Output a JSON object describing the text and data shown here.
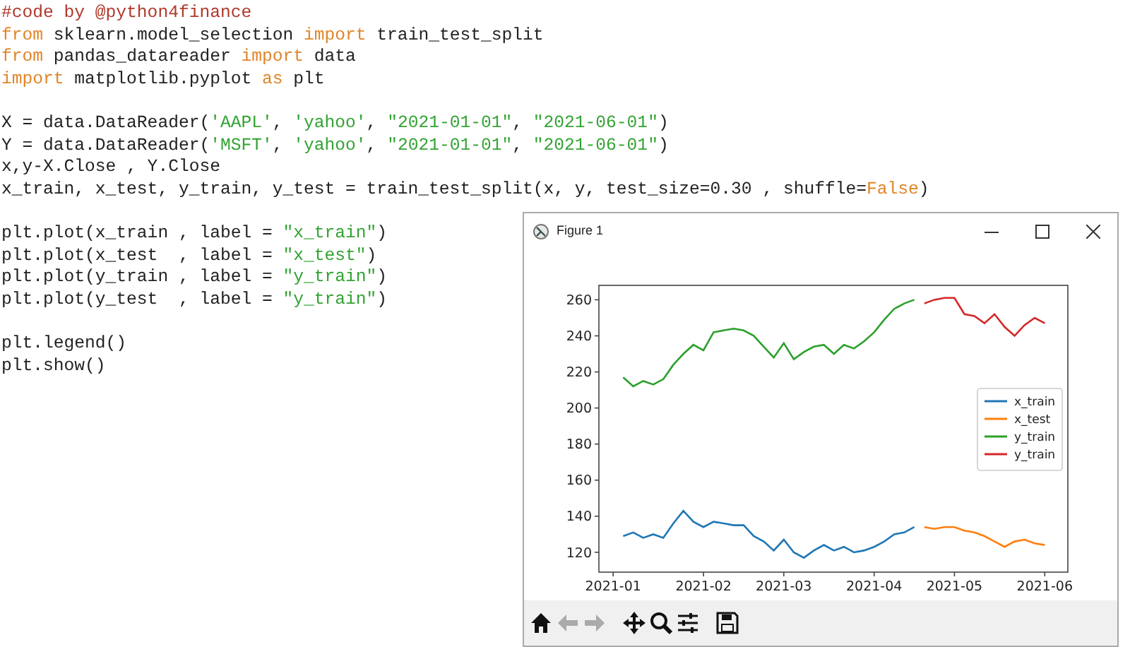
{
  "code_lines": [
    {
      "tokens": [
        {
          "text": "#code by @python4finance",
          "kind": "comment"
        }
      ]
    },
    {
      "tokens": [
        {
          "text": "from",
          "kind": "keyword"
        },
        {
          "text": " sklearn.model_selection ",
          "kind": "plain"
        },
        {
          "text": "import",
          "kind": "keyword"
        },
        {
          "text": " train_test_split",
          "kind": "plain"
        }
      ]
    },
    {
      "tokens": [
        {
          "text": "from",
          "kind": "keyword"
        },
        {
          "text": " pandas_datareader ",
          "kind": "plain"
        },
        {
          "text": "import",
          "kind": "keyword"
        },
        {
          "text": " data",
          "kind": "plain"
        }
      ]
    },
    {
      "tokens": [
        {
          "text": "import",
          "kind": "keyword"
        },
        {
          "text": " matplotlib.pyplot ",
          "kind": "plain"
        },
        {
          "text": "as",
          "kind": "keyword"
        },
        {
          "text": " plt",
          "kind": "plain"
        }
      ]
    },
    {
      "kind": "blank"
    },
    {
      "tokens": [
        {
          "text": "X = data.DataReader(",
          "kind": "plain"
        },
        {
          "text": "'AAPL'",
          "kind": "string"
        },
        {
          "text": ", ",
          "kind": "plain"
        },
        {
          "text": "'yahoo'",
          "kind": "string"
        },
        {
          "text": ", ",
          "kind": "plain"
        },
        {
          "text": "\"2021-01-01\"",
          "kind": "string"
        },
        {
          "text": ", ",
          "kind": "plain"
        },
        {
          "text": "\"2021-06-01\"",
          "kind": "string"
        },
        {
          "text": ")",
          "kind": "plain"
        }
      ]
    },
    {
      "tokens": [
        {
          "text": "Y = data.DataReader(",
          "kind": "plain"
        },
        {
          "text": "'MSFT'",
          "kind": "string"
        },
        {
          "text": ", ",
          "kind": "plain"
        },
        {
          "text": "'yahoo'",
          "kind": "string"
        },
        {
          "text": ", ",
          "kind": "plain"
        },
        {
          "text": "\"2021-01-01\"",
          "kind": "string"
        },
        {
          "text": ", ",
          "kind": "plain"
        },
        {
          "text": "\"2021-06-01\"",
          "kind": "string"
        },
        {
          "text": ")",
          "kind": "plain"
        }
      ]
    },
    {
      "tokens": [
        {
          "text": "x,y-X.Close , Y.Close",
          "kind": "plain"
        }
      ]
    },
    {
      "tokens": [
        {
          "text": "x_train, x_test, y_train, y_test = train_test_split(x, y, test_size=0.30 , shuffle=",
          "kind": "plain"
        },
        {
          "text": "False",
          "kind": "keyword"
        },
        {
          "text": ")",
          "kind": "plain"
        }
      ]
    },
    {
      "kind": "blank"
    },
    {
      "tokens": [
        {
          "text": "plt.plot(x_train , label = ",
          "kind": "plain"
        },
        {
          "text": "\"x_train\"",
          "kind": "string"
        },
        {
          "text": ")",
          "kind": "plain"
        }
      ]
    },
    {
      "tokens": [
        {
          "text": "plt.plot(x_test  , label = ",
          "kind": "plain"
        },
        {
          "text": "\"x_test\"",
          "kind": "string"
        },
        {
          "text": ")",
          "kind": "plain"
        }
      ]
    },
    {
      "tokens": [
        {
          "text": "plt.plot(y_train , label = ",
          "kind": "plain"
        },
        {
          "text": "\"y_train\"",
          "kind": "string"
        },
        {
          "text": ")",
          "kind": "plain"
        }
      ]
    },
    {
      "tokens": [
        {
          "text": "plt.plot(y_test  , label = ",
          "kind": "plain"
        },
        {
          "text": "\"y_train\"",
          "kind": "string"
        },
        {
          "text": ")",
          "kind": "plain"
        }
      ]
    },
    {
      "kind": "blank"
    },
    {
      "tokens": [
        {
          "text": "plt.legend()",
          "kind": "plain"
        }
      ]
    },
    {
      "tokens": [
        {
          "text": "plt.show()",
          "kind": "plain"
        }
      ]
    }
  ],
  "figure_window": {
    "title": "Figure 1",
    "chart_data": {
      "type": "line",
      "categories": [
        "2021-01",
        null,
        null,
        null,
        null,
        null,
        null,
        null,
        null,
        "2021-02",
        null,
        null,
        null,
        null,
        null,
        null,
        null,
        "2021-03",
        null,
        null,
        null,
        null,
        null,
        null,
        null,
        null,
        "2021-04",
        null,
        null,
        null,
        null,
        null,
        null,
        null,
        "2021-05",
        null,
        null,
        null,
        null,
        null,
        null,
        null,
        null,
        "2021-06"
      ],
      "series": [
        {
          "name": "x_train",
          "color": "#1f77b4",
          "values": [
            null,
            129,
            131,
            128,
            130,
            128,
            136,
            143,
            137,
            134,
            137,
            136,
            135,
            135,
            129,
            126,
            121,
            127,
            120,
            117,
            121,
            124,
            121,
            123,
            120,
            121,
            123,
            126,
            130,
            131,
            134,
            null,
            null,
            null,
            null,
            null,
            null,
            null,
            null,
            null,
            null,
            null,
            null,
            null
          ]
        },
        {
          "name": "x_test",
          "color": "#ff7f0e",
          "values": [
            null,
            null,
            null,
            null,
            null,
            null,
            null,
            null,
            null,
            null,
            null,
            null,
            null,
            null,
            null,
            null,
            null,
            null,
            null,
            null,
            null,
            null,
            null,
            null,
            null,
            null,
            null,
            null,
            null,
            null,
            null,
            134,
            133,
            134,
            134,
            132,
            131,
            129,
            126,
            123,
            126,
            127,
            125,
            124
          ]
        },
        {
          "name": "y_train",
          "color": "#2ca02c",
          "values": [
            null,
            217,
            212,
            215,
            213,
            216,
            224,
            230,
            235,
            232,
            242,
            243,
            244,
            243,
            240,
            234,
            228,
            236,
            227,
            231,
            234,
            235,
            230,
            235,
            233,
            237,
            242,
            249,
            255,
            258,
            260,
            null,
            null,
            null,
            null,
            null,
            null,
            null,
            null,
            null,
            null,
            null,
            null,
            null
          ]
        },
        {
          "name": "y_train",
          "color": "#d62728",
          "values": [
            null,
            null,
            null,
            null,
            null,
            null,
            null,
            null,
            null,
            null,
            null,
            null,
            null,
            null,
            null,
            null,
            null,
            null,
            null,
            null,
            null,
            null,
            null,
            null,
            null,
            null,
            null,
            null,
            null,
            null,
            null,
            258,
            260,
            261,
            261,
            252,
            251,
            247,
            252,
            245,
            240,
            246,
            250,
            247
          ]
        }
      ],
      "ylim": [
        109,
        268
      ],
      "legend": "center right",
      "yticks": [
        120,
        140,
        160,
        180,
        200,
        220,
        240,
        260
      ]
    }
  }
}
